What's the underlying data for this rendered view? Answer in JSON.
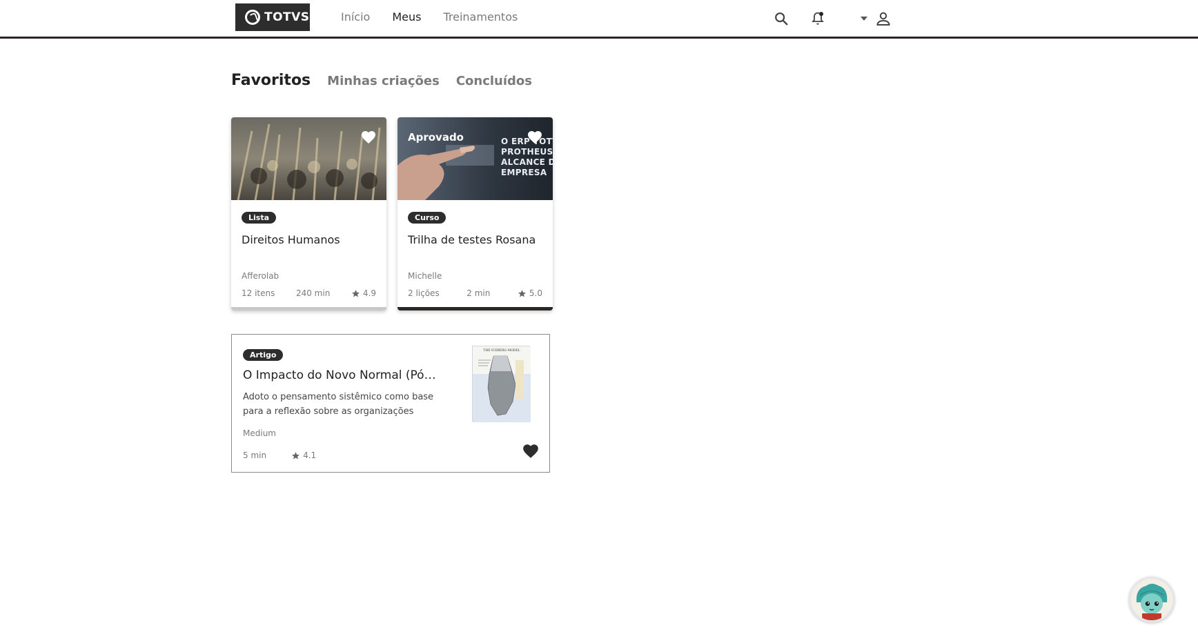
{
  "header": {
    "logo_text": "TOTVS",
    "nav": [
      {
        "label": "Início",
        "active": false
      },
      {
        "label": "Meus",
        "active": true
      },
      {
        "label": "Treinamentos",
        "active": false
      }
    ],
    "icons": [
      "search-icon",
      "bell-icon",
      "chevron-down-icon",
      "user-icon"
    ]
  },
  "tabs": [
    {
      "label": "Favoritos",
      "active": true
    },
    {
      "label": "Minhas criações",
      "active": false
    },
    {
      "label": "Concluídos",
      "active": false
    }
  ],
  "cards": [
    {
      "badge": "Lista",
      "title": "Direitos Humanos",
      "author": "Afferolab",
      "items": "12 itens",
      "duration": "240 min",
      "rating": "4.9",
      "favorited": true
    },
    {
      "status": "Aprovado",
      "overlay_text": [
        "O ERP TOTV",
        "PROTHEUS",
        "ALCANCE D",
        "EMPRESA"
      ],
      "badge": "Curso",
      "title": "Trilha de testes Rosana",
      "author": "Michelle",
      "items": "2 lições",
      "duration": "2 min",
      "rating": "5.0",
      "favorited": true
    }
  ],
  "article": {
    "badge": "Artigo",
    "title": "O Impacto do Novo Normal (Pós...",
    "description": "Adoto o pensamento sistêmico como base para a reflexão sobre as organizações de...",
    "author": "Medium",
    "duration": "5 min",
    "rating": "4.1",
    "thumbnail_caption": "THE ICEBERG MODEL",
    "favorited": true
  },
  "colors": {
    "dark": "#2d2d2d",
    "muted_text": "#7a7a7a",
    "header_rule": "#2a2424"
  }
}
